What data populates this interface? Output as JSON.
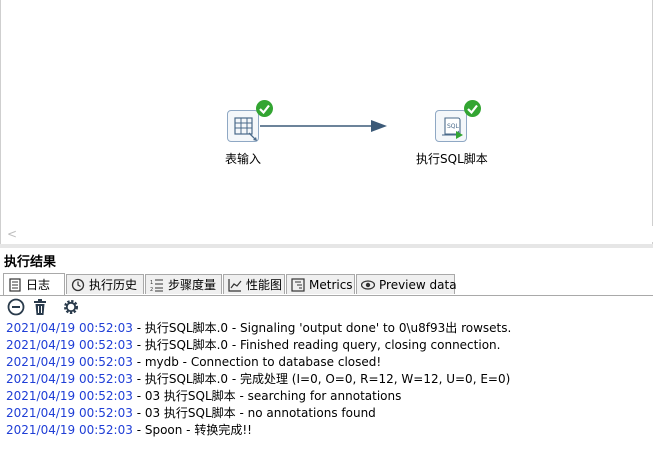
{
  "canvas": {
    "steps": [
      {
        "label": "表输入",
        "icon": "table-input-icon",
        "status": "ok"
      },
      {
        "label": "执行SQL脚本",
        "icon": "sql-script-icon",
        "status": "ok"
      }
    ]
  },
  "results": {
    "title": "执行结果",
    "tabs": [
      {
        "label": "日志",
        "icon": "log-icon",
        "active": true
      },
      {
        "label": "执行历史",
        "icon": "history-icon"
      },
      {
        "label": "步骤度量",
        "icon": "step-metrics-icon"
      },
      {
        "label": "性能图",
        "icon": "performance-graph-icon"
      },
      {
        "label": "Metrics",
        "icon": "metrics-icon"
      },
      {
        "label": "Preview data",
        "icon": "preview-eye-icon"
      }
    ],
    "toolbar": [
      "clear-log-icon",
      "delete-icon",
      "settings-icon"
    ],
    "log": [
      {
        "ts": "2021/04/19 00:52:03",
        "msg": " - 执行SQL脚本.0 - Signaling 'output done' to 0\\u8f93出 rowsets."
      },
      {
        "ts": "2021/04/19 00:52:03",
        "msg": " - 执行SQL脚本.0 - Finished reading query, closing connection."
      },
      {
        "ts": "2021/04/19 00:52:03",
        "msg": " - mydb - Connection to database closed!"
      },
      {
        "ts": "2021/04/19 00:52:03",
        "msg": " - 执行SQL脚本.0 - 完成处理 (I=0, O=0, R=12, W=12, U=0, E=0)"
      },
      {
        "ts": "2021/04/19 00:52:03",
        "msg": " - 03 执行SQL脚本 - searching for annotations"
      },
      {
        "ts": "2021/04/19 00:52:03",
        "msg": " - 03 执行SQL脚本 - no annotations found"
      },
      {
        "ts": "2021/04/19 00:52:03",
        "msg": " - Spoon - 转换完成!!"
      }
    ]
  },
  "colors": {
    "timestamp": "#1f3ed6",
    "ok": "#33a532",
    "hop": "#3c5a78"
  }
}
